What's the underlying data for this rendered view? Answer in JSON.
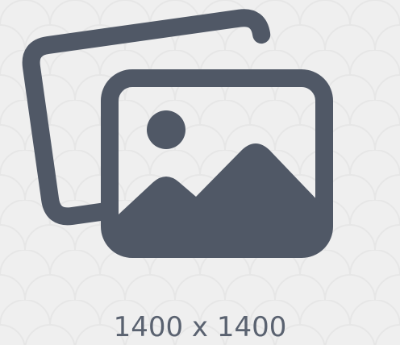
{
  "image_placeholder": {
    "icon": "image-gallery-icon",
    "dimensions_text": "1400 x 1400",
    "colors": {
      "background": "#efefef",
      "pattern": "#e9e9e9",
      "icon": "#505866",
      "text": "#5a6270"
    }
  }
}
